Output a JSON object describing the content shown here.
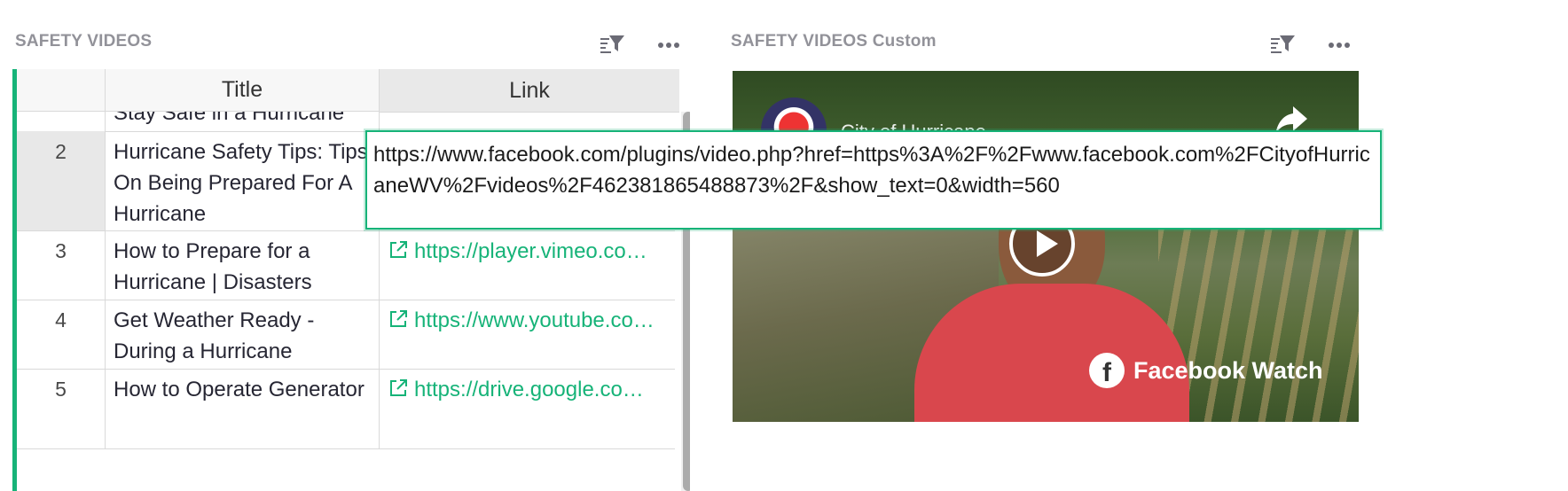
{
  "left_widget": {
    "title": "SAFETY VIDEOS",
    "sort_filter_icon": "sort-filter-icon",
    "menu_icon": "more-dots-icon",
    "columns": {
      "row_header": "",
      "title": "Title",
      "link": "Link"
    },
    "partial_row": {
      "title": "Stay Safe in a Hurricane"
    },
    "rows": [
      {
        "num": "2",
        "title": "Hurricane Safety Tips: Tips On Being Prepared For A Hurricane",
        "link": ""
      },
      {
        "num": "3",
        "title": "How to Prepare for a Hurricane | Disasters",
        "link": "https://player.vimeo.co…"
      },
      {
        "num": "4",
        "title": "Get Weather Ready - During a Hurricane",
        "link": "https://www.youtube.co…"
      },
      {
        "num": "5",
        "title": "How to Operate Generator",
        "link": "https://drive.google.co…"
      }
    ],
    "link_icon": "external-link-icon"
  },
  "right_widget": {
    "title": "SAFETY VIDEOS Custom",
    "sort_filter_icon": "sort-filter-icon",
    "menu_icon": "more-dots-icon",
    "video": {
      "channel": "City of Hurricane",
      "badge": "Facebook Watch",
      "badge_logo": "f"
    }
  },
  "editor": {
    "value": "https://www.facebook.com/plugins/video.php?href=https%3A%2F%2Fwww.facebook.com%2FCityofHurricaneWV%2Fvideos%2F462381865488873%2F&show_text=0&width=560"
  },
  "colors": {
    "accent": "#16b378",
    "muted_title": "#929299"
  }
}
